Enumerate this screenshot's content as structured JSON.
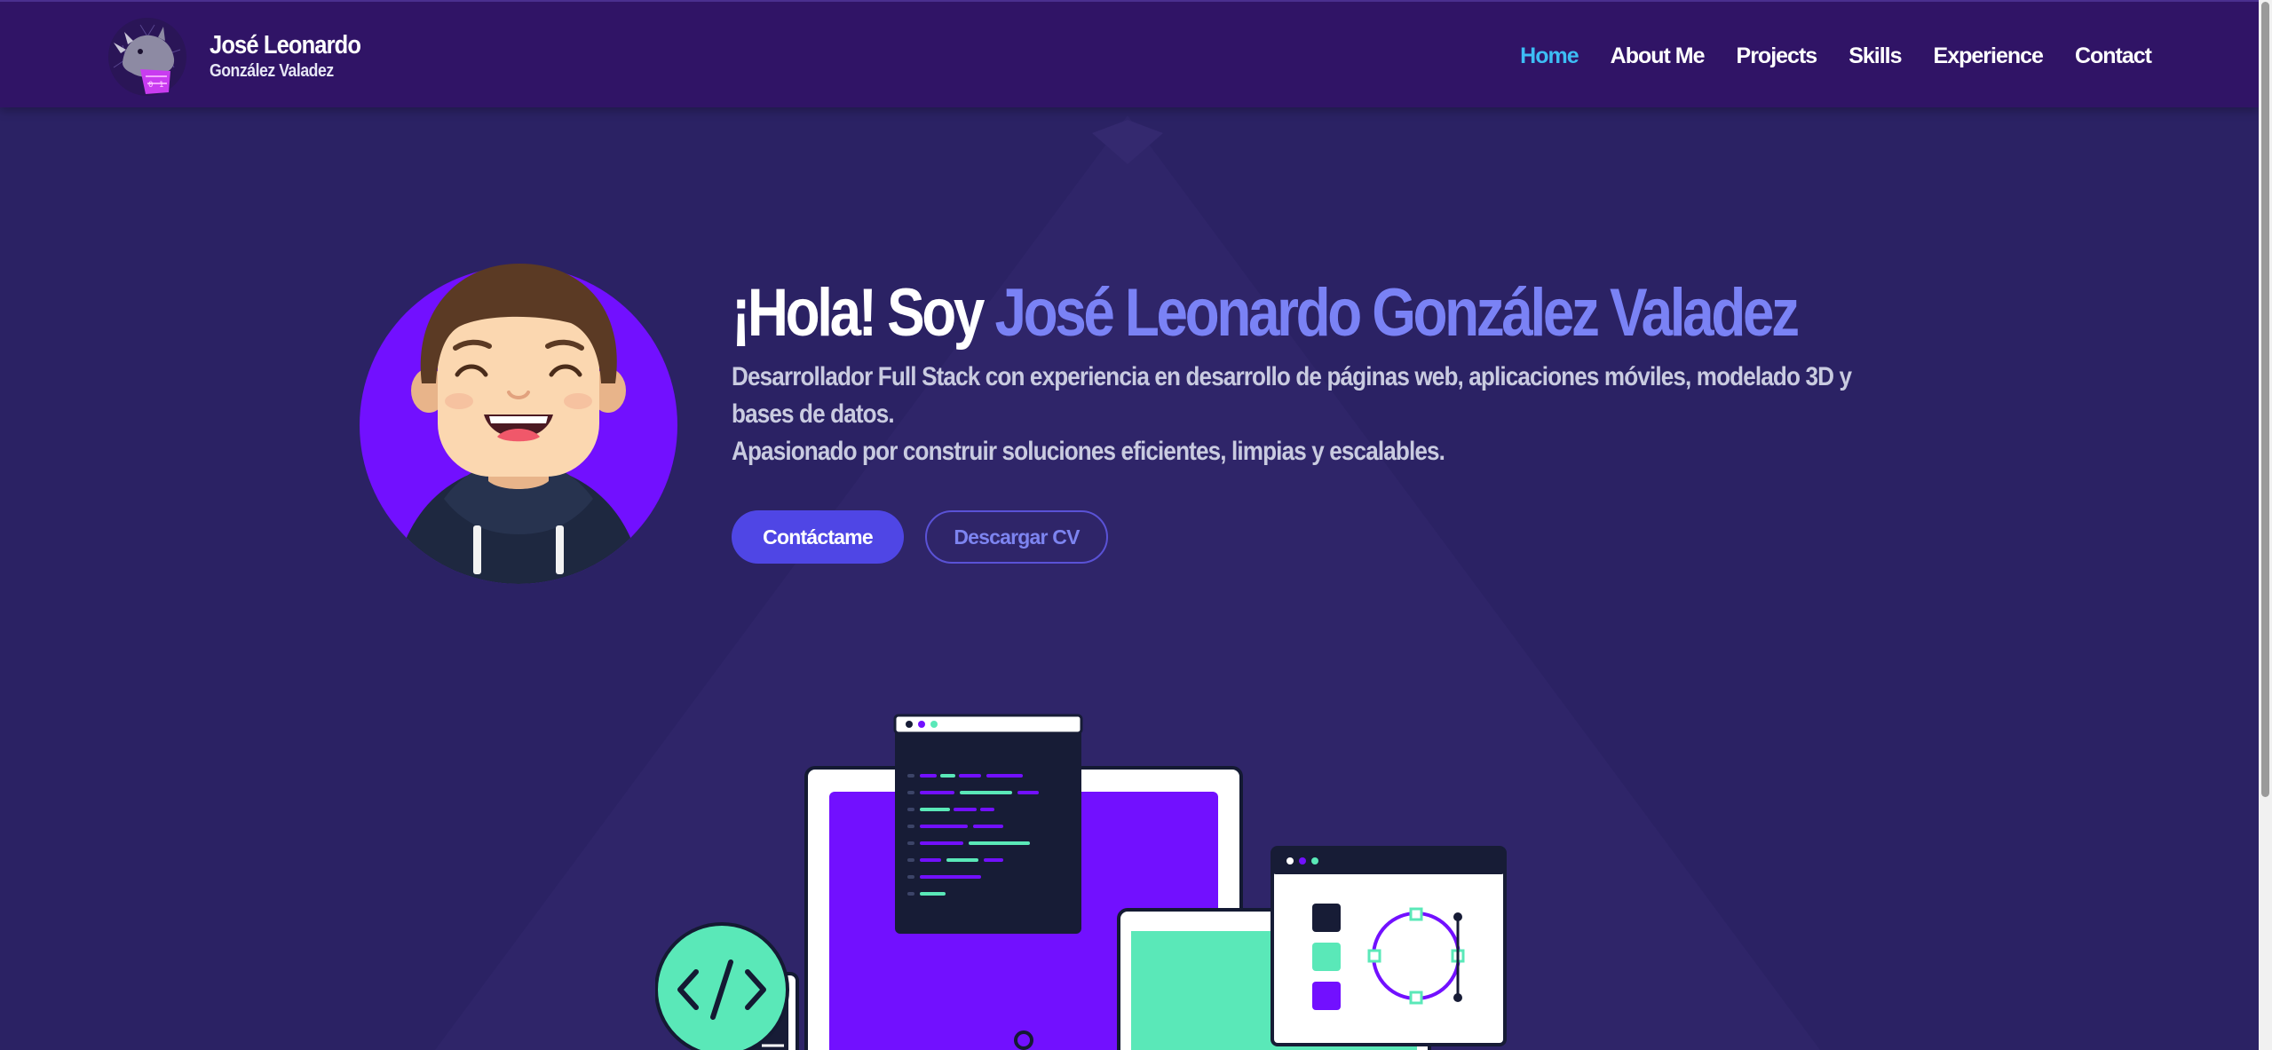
{
  "brand": {
    "name": "José Leonardo",
    "surname": "González Valadez"
  },
  "nav": {
    "items": [
      {
        "label": "Home",
        "active": true
      },
      {
        "label": "About Me",
        "active": false
      },
      {
        "label": "Projects",
        "active": false
      },
      {
        "label": "Skills",
        "active": false
      },
      {
        "label": "Experience",
        "active": false
      },
      {
        "label": "Contact",
        "active": false
      }
    ]
  },
  "hero": {
    "greeting": "¡Hola! Soy ",
    "name": "José Leonardo González Valadez",
    "description_line1": "Desarrollador Full Stack con experiencia en desarrollo de páginas web, aplicaciones móviles, modelado 3D y bases de datos.",
    "description_line2": "Apasionado por construir soluciones eficientes, limpias y escalables.",
    "contact_button": "Contáctame",
    "cv_button": "Descargar CV"
  },
  "colors": {
    "background": "#2b2264",
    "header": "#301466",
    "accent": "#4f46e5",
    "highlight": "#7a82f5",
    "active_link": "#3dbdf5",
    "purple": "#7210ff",
    "mint": "#5ae8b8"
  },
  "icons": {
    "logo": "rhino-logo-icon",
    "avatar": "developer-avatar",
    "code": "code-brackets-icon"
  }
}
